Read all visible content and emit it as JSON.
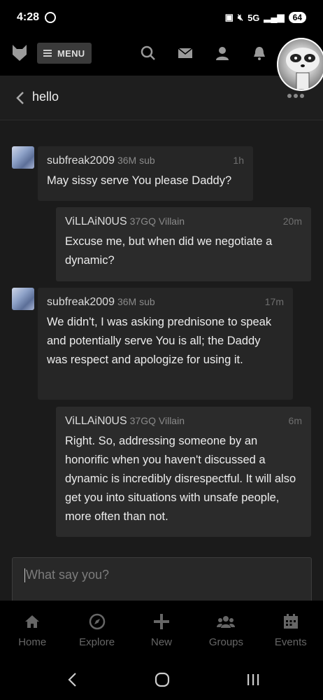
{
  "status_bar": {
    "time": "4:28",
    "network": "5G",
    "battery": "64"
  },
  "nav": {
    "menu_label": "MENU",
    "icons": [
      "fetlife-logo-icon",
      "search-icon",
      "mail-icon",
      "person-icon",
      "bell-icon"
    ]
  },
  "header": {
    "title": "hello"
  },
  "messages": [
    {
      "user": "subfreak2009",
      "badge": "36M sub",
      "time": "1h",
      "text": "May sissy serve You please Daddy?"
    },
    {
      "user": "ViLLAiN0US",
      "badge": "37GQ Villain",
      "time": "20m",
      "text": "Excuse me, but when did we negotiate a dynamic?"
    },
    {
      "user": "subfreak2009",
      "badge": "36M sub",
      "time": "17m",
      "text": "We didn't, I was asking prednisone to speak and potentially serve You is all; the Daddy was respect and apologize for using it."
    },
    {
      "user": "ViLLAiN0US",
      "badge": "37GQ Villain",
      "time": "6m",
      "text": "Right. So, addressing someone by an honorific when you haven't discussed a dynamic is incredibly disrespectful. It will also get you into situations with unsafe people, more often than not."
    }
  ],
  "composer": {
    "placeholder": "What say you?"
  },
  "tabs": [
    {
      "label": "Home",
      "icon": "home-icon"
    },
    {
      "label": "Explore",
      "icon": "compass-icon"
    },
    {
      "label": "New",
      "icon": "plus-icon"
    },
    {
      "label": "Groups",
      "icon": "groups-icon"
    },
    {
      "label": "Events",
      "icon": "calendar-icon"
    }
  ]
}
